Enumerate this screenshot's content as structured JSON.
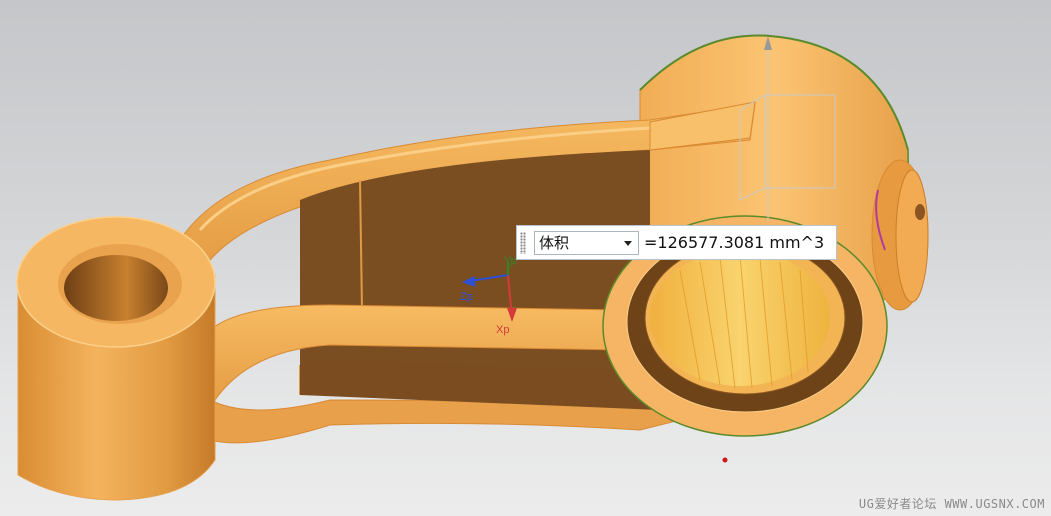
{
  "measure": {
    "dropdown_value": "体积",
    "result_text": "=126577.3081 mm^3"
  },
  "triad": {
    "x_label": "Xp",
    "y_label": "Yp",
    "z_label": "Zp"
  },
  "watermark": "UG爱好者论坛 WWW.UGSNX.COM",
  "colors": {
    "part_face": "#f2a94c",
    "part_shadow": "#7a4d22",
    "edge_highlight": "#5a8a2a",
    "x_axis": "#d33a3a",
    "y_axis": "#2a8a2a",
    "z_axis": "#2c4fd6"
  }
}
